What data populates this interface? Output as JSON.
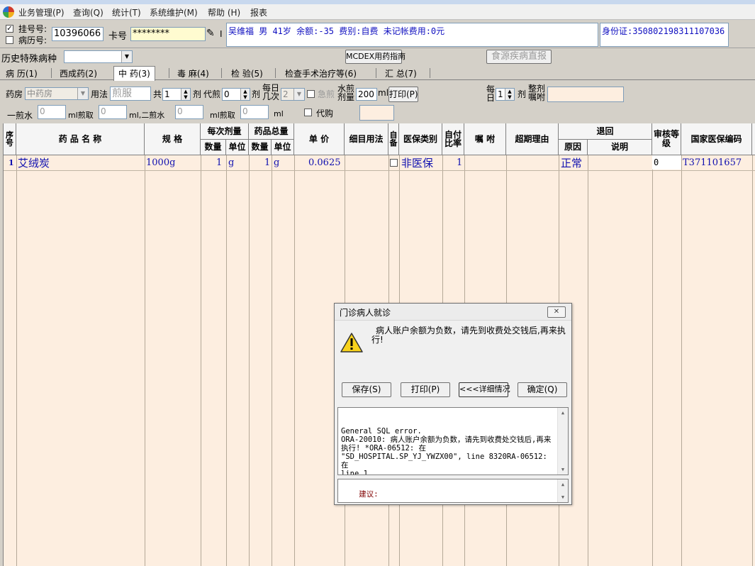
{
  "menu": {
    "items": [
      "业务管理(P)",
      "查询(Q)",
      "统计(T)",
      "系统维护(M)",
      "帮助 (H)",
      "报表"
    ]
  },
  "patient": {
    "reg_no_label": "挂号号:",
    "record_no_label": "病历号:",
    "reg_no": "10396066",
    "card_label": "卡号",
    "card_value": "********",
    "card_btn": "I",
    "info": "吴维福 男 41岁 余额:-35 费别:自费 未记帐费用:0元",
    "id_card": "身份证:350802198311107036",
    "reg_checked": "✓"
  },
  "row2": {
    "history_label": "历史特殊病种",
    "mcdex_btn": "MCDEX用药指南",
    "food_btn": "食源疾病直报"
  },
  "tabs": [
    "病 历(1)",
    "西成药(2)",
    "中 药(3)",
    "毒 麻(4)",
    "检 验(5)",
    "检查手术治疗等(6)",
    "汇 总(7)"
  ],
  "herb_form": {
    "pharmacy_label": "药房",
    "pharmacy_value": "中药房",
    "usage_label": "用法",
    "usage_value": "煎服",
    "total_label": "共",
    "total_value": "1",
    "dose_unit": "剂",
    "before_label": "代煎",
    "before_value": "0",
    "dose_unit2": "剂",
    "daily_times_label": "每日几次",
    "daily_times_value": "2",
    "urgent_label": "急煎",
    "water_label": "水煎剂量",
    "water_value": "200",
    "ml_unit": "ml",
    "print_btn": "打印(P)",
    "per_day_label": "每日",
    "per_day_value": "1",
    "dose_unit3": "剂",
    "instruct_label": "整剂嘱咐",
    "instruct_value": "",
    "first_water_label": "一煎水",
    "first_water_value": "0",
    "ml_take_label": "ml煎取",
    "first_take_value": "0",
    "second_label": "ml,二煎水",
    "second_water_value": "0",
    "ml_take_label2": "ml煎取",
    "second_take_value": "0",
    "ml_end": "ml",
    "proxy_label": "代购",
    "proxy_value": ""
  },
  "grid": {
    "headers": {
      "seq": "序号",
      "name": "药 品 名 称",
      "spec": "规 格",
      "per_dose": "每次剂量",
      "per_qty": "数量",
      "per_unit": "单位",
      "total": "药品总量",
      "tot_qty": "数量",
      "tot_unit": "单位",
      "price": "单 价",
      "usage": "细目用法",
      "self": "自备",
      "insurance": "医保类别",
      "ratio": "自付比率",
      "instruct": "嘱 咐",
      "overdue": "超期理由",
      "return": "退回",
      "reason": "原因",
      "note": "说明",
      "audit": "审核等级",
      "nat_code": "国家医保编码"
    },
    "rows": [
      {
        "seq": "1",
        "name": "艾绒炭",
        "spec": "1000g",
        "per_qty": "1",
        "per_unit": "g",
        "tot_qty": "1",
        "tot_unit": "g",
        "price": "0.0625",
        "usage": "",
        "insurance": "非医保",
        "ratio": "1",
        "instruct": "",
        "overdue": "",
        "reason": "正常",
        "note": "",
        "audit": "0",
        "nat_code": "T371101657"
      }
    ]
  },
  "dialog": {
    "title": "门诊病人就诊",
    "message": "病人账户余额为负数，请先到收费处交钱后,再来执行!",
    "buttons": {
      "save": "保存(S)",
      "print": "打印(P)",
      "details": "<<<详细情况",
      "ok": "确定(Q)"
    },
    "detail_text": "General SQL error.\nORA-20010: 病人账户余额为负数，请先到收费处交钱后,再来执行! *ORA-06512: 在\n\"SD_HOSPITAL.SP_YJ_YWZX00\", line 8320RA-06512: 在\nline 1",
    "advice_label": "建议:"
  }
}
